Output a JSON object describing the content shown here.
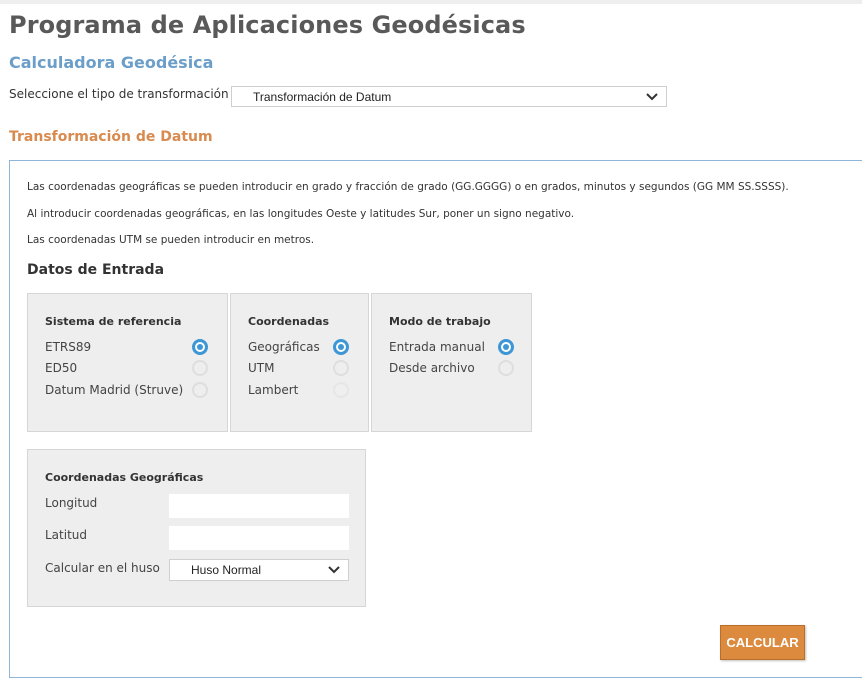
{
  "header": {
    "title": "Programa de Aplicaciones Geodésicas",
    "subtitle": "Calculadora Geodésica"
  },
  "transform": {
    "label": "Seleccione el tipo de transformación",
    "selected": "Transformación de Datum"
  },
  "section_title": "Transformación de Datum",
  "info": [
    "Las coordenadas geográficas se pueden introducir en grado y fracción de grado (GG.GGGG) o en grados, minutos y segundos (GG MM SS.SSSS).",
    "Al introducir coordenadas geográficas, en las longitudes Oeste y latitudes Sur, poner un signo negativo.",
    "Las coordenadas UTM se pueden introducir en metros."
  ],
  "entrada_title": "Datos de Entrada",
  "sistema": {
    "title": "Sistema de referencia",
    "options": [
      "ETRS89",
      "ED50",
      "Datum Madrid (Struve)"
    ],
    "selected": "ETRS89"
  },
  "coordenadas": {
    "title": "Coordenadas",
    "options": [
      "Geográficas",
      "UTM",
      "Lambert"
    ],
    "selected": "Geográficas"
  },
  "modo": {
    "title": "Modo de trabajo",
    "options": [
      "Entrada manual",
      "Desde archivo"
    ],
    "selected": "Entrada manual"
  },
  "geo": {
    "title": "Coordenadas Geográficas",
    "longitud_label": "Longitud",
    "longitud_value": "",
    "latitud_label": "Latitud",
    "latitud_value": "",
    "huso_label": "Calcular en el huso",
    "huso_selected": "Huso Normal"
  },
  "button": {
    "calcular": "CALCULAR"
  },
  "colors": {
    "title_gray": "#595959",
    "subtitle_blue": "#6b9ec9",
    "section_orange": "#d98a4e",
    "panel_border": "#8fb6d9",
    "radio_blue": "#3d96d6",
    "button_orange": "#dc8a3d"
  }
}
